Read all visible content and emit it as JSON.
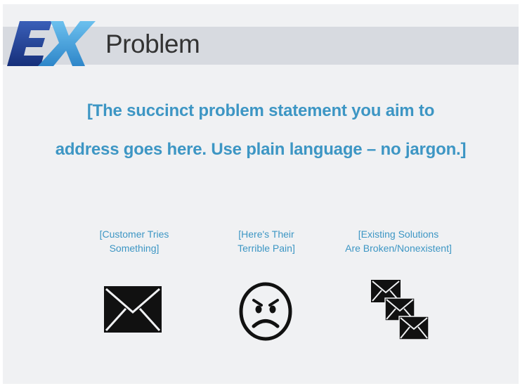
{
  "slide": {
    "logo_text": "EX",
    "title": "Problem",
    "statement_line1": "[The succinct problem statement you aim to",
    "statement_line2": "address goes here. Use plain language – no jargon.]"
  },
  "columns": [
    {
      "caption_line1": "[Customer Tries",
      "caption_line2": "Something]",
      "icon": "envelope-icon"
    },
    {
      "caption_line1": "[Here's Their",
      "caption_line2": "Terrible Pain]",
      "icon": "frowning-face-icon"
    },
    {
      "caption_line1": "[Existing Solutions",
      "caption_line2": "Are Broken/Nonexistent]",
      "icon": "stacked-envelopes-icon"
    }
  ],
  "colors": {
    "accent_blue": "#3d96c4",
    "logo_blue_dark": "#1e3d8f",
    "logo_blue_light": "#4aa8e0",
    "header_band": "#d7dae0",
    "background": "#f0f1f3"
  }
}
